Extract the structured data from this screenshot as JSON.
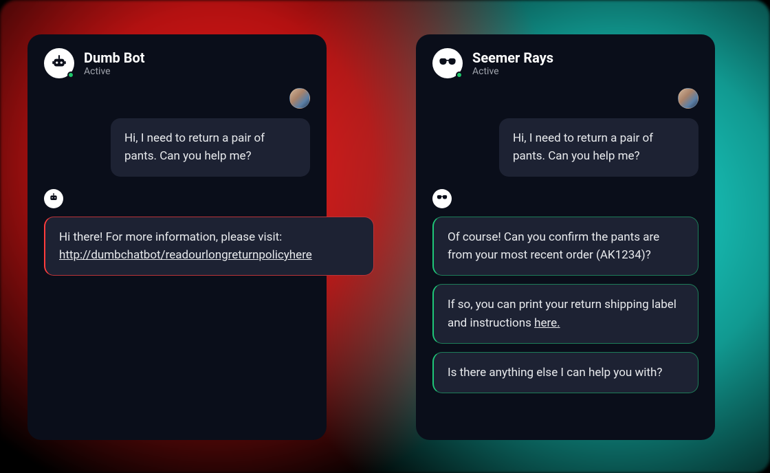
{
  "left": {
    "name": "Dumb Bot",
    "status": "Active",
    "user_message": "Hi, I need to return a pair of pants. Can you help me?",
    "bot_text": "Hi there! For more information, please visit:",
    "bot_link": "http://dumbchatbot/readourlongreturnpolicyhere"
  },
  "right": {
    "name": "Seemer Rays",
    "status": "Active",
    "user_message": "Hi, I need to return a pair of pants. Can you help me?",
    "bot_msg1": "Of course!  Can you confirm the pants are from your most recent order (AK1234)?",
    "bot_msg2_a": "If so, you can print your return shipping label and instructions ",
    "bot_msg2_link": "here.",
    "bot_msg3": "Is there anything else I can help you with?"
  }
}
